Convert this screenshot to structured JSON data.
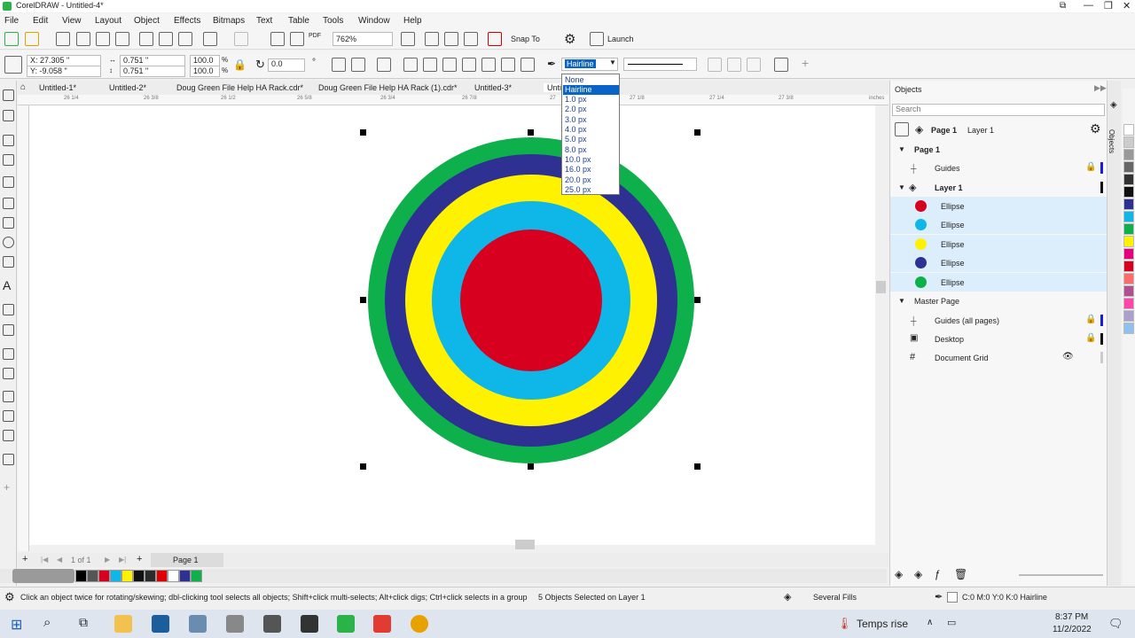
{
  "window": {
    "title": "CorelDRAW - Untitled-4*"
  },
  "menu": [
    "File",
    "Edit",
    "View",
    "Layout",
    "Object",
    "Effects",
    "Bitmaps",
    "Text",
    "Table",
    "Tools",
    "Window",
    "Help"
  ],
  "toolbar": {
    "zoom": "762%",
    "snap_to": "Snap To",
    "launch": "Launch",
    "pdf": "PDF"
  },
  "propbar": {
    "x": "X: 27.305 \"",
    "y": "Y: -9.058 \"",
    "w": "0.751 \"",
    "h": "0.751 \"",
    "scale_w": "100.0",
    "scale_h": "100.0",
    "percent": "%",
    "rotation": "0.0",
    "outline_width": "Hairline",
    "degree": "°"
  },
  "tabs": [
    "Untitled-1*",
    "Untitled-2*",
    "Doug Green File Help HA Rack.cdr*",
    "Doug Green File Help HA Rack (1).cdr*",
    "Untitled-3*",
    "Unti"
  ],
  "ruler_labels": [
    "26 1/4",
    "26 3/8",
    "26 1/2",
    "26 5/8",
    "26 3/4",
    "26 7/8",
    "27",
    "27 1/8",
    "27 1/4",
    "27 3/8",
    "27 1/2",
    "27 5/8",
    "27 3/4",
    "inches"
  ],
  "outline_dropdown": {
    "options": [
      "None",
      "Hairline",
      "1.0 px",
      "2.0 px",
      "3.0 px",
      "4.0 px",
      "5.0 px",
      "8.0 px",
      "10.0 px",
      "16.0 px",
      "20.0 px",
      "25.0 px"
    ],
    "selected": "Hairline"
  },
  "canvas": {
    "rings": [
      {
        "name": "green",
        "color": "#0db04b"
      },
      {
        "name": "navy",
        "color": "#2e3192"
      },
      {
        "name": "yellow",
        "color": "#fff200"
      },
      {
        "name": "cyan",
        "color": "#0fb7e8"
      },
      {
        "name": "red",
        "color": "#d7001f"
      }
    ]
  },
  "pagebar": {
    "page_count": "1  of 1",
    "page_tab": "Page 1"
  },
  "status": {
    "hint": "Click an object twice for rotating/skewing; dbl-clicking tool selects all objects; Shift+click multi-selects; Alt+click digs; Ctrl+click selects in a group",
    "selection": "5 Objects Selected on Layer 1",
    "fill": "Several Fills",
    "outline": "C:0 M:0 Y:0 K:0  Hairline"
  },
  "objects_panel": {
    "title": "Objects",
    "search_placeholder": "Search",
    "current_page": "Page 1",
    "current_layer": "Layer 1",
    "page": "Page 1",
    "guides": "Guides",
    "layer": "Layer 1",
    "ellipses": [
      {
        "label": "Ellipse",
        "color": "#d7001f"
      },
      {
        "label": "Ellipse",
        "color": "#0fb7e8"
      },
      {
        "label": "Ellipse",
        "color": "#fff200"
      },
      {
        "label": "Ellipse",
        "color": "#2e3192"
      },
      {
        "label": "Ellipse",
        "color": "#0db04b"
      }
    ],
    "master_page": "Master Page",
    "guides_all": "Guides (all pages)",
    "desktop": "Desktop",
    "document_grid": "Document Grid",
    "side_tab": "Objects"
  },
  "bottom_palette": [
    "#000000",
    "#555555",
    "#d7001f",
    "#0fb7e8",
    "#fff200",
    "#111111",
    "#2b2b2b",
    "#e00000",
    "#ffffff",
    "#2e3192",
    "#0db04b"
  ],
  "right_palette": [
    "#ffffff",
    "#cccccc",
    "#999999",
    "#666666",
    "#333333",
    "#111111",
    "#2e3192",
    "#0fb7e8",
    "#0db04b",
    "#fff200",
    "#e6007e",
    "#d7001f",
    "#ff6b6b",
    "#b05090",
    "#f4a",
    "#aaa0d0",
    "#90c0f0"
  ],
  "taskbar": {
    "weather": "Temps rise",
    "time": "8:37 PM",
    "date": "11/2/2022"
  }
}
